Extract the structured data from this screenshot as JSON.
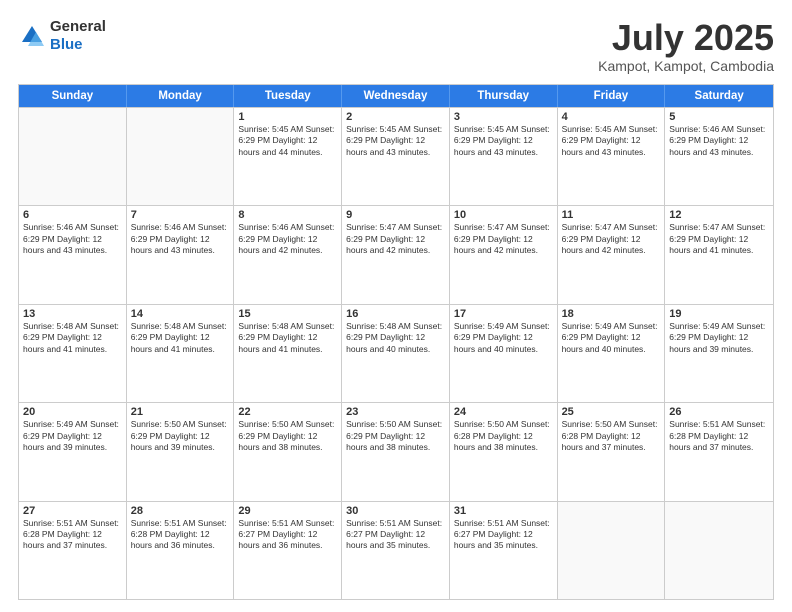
{
  "logo": {
    "general": "General",
    "blue": "Blue"
  },
  "title": "July 2025",
  "location": "Kampot, Kampot, Cambodia",
  "days_of_week": [
    "Sunday",
    "Monday",
    "Tuesday",
    "Wednesday",
    "Thursday",
    "Friday",
    "Saturday"
  ],
  "weeks": [
    [
      {
        "day": "",
        "info": "",
        "empty": true
      },
      {
        "day": "",
        "info": "",
        "empty": true
      },
      {
        "day": "1",
        "info": "Sunrise: 5:45 AM\nSunset: 6:29 PM\nDaylight: 12 hours and 44 minutes."
      },
      {
        "day": "2",
        "info": "Sunrise: 5:45 AM\nSunset: 6:29 PM\nDaylight: 12 hours and 43 minutes."
      },
      {
        "day": "3",
        "info": "Sunrise: 5:45 AM\nSunset: 6:29 PM\nDaylight: 12 hours and 43 minutes."
      },
      {
        "day": "4",
        "info": "Sunrise: 5:45 AM\nSunset: 6:29 PM\nDaylight: 12 hours and 43 minutes."
      },
      {
        "day": "5",
        "info": "Sunrise: 5:46 AM\nSunset: 6:29 PM\nDaylight: 12 hours and 43 minutes."
      }
    ],
    [
      {
        "day": "6",
        "info": "Sunrise: 5:46 AM\nSunset: 6:29 PM\nDaylight: 12 hours and 43 minutes."
      },
      {
        "day": "7",
        "info": "Sunrise: 5:46 AM\nSunset: 6:29 PM\nDaylight: 12 hours and 43 minutes."
      },
      {
        "day": "8",
        "info": "Sunrise: 5:46 AM\nSunset: 6:29 PM\nDaylight: 12 hours and 42 minutes."
      },
      {
        "day": "9",
        "info": "Sunrise: 5:47 AM\nSunset: 6:29 PM\nDaylight: 12 hours and 42 minutes."
      },
      {
        "day": "10",
        "info": "Sunrise: 5:47 AM\nSunset: 6:29 PM\nDaylight: 12 hours and 42 minutes."
      },
      {
        "day": "11",
        "info": "Sunrise: 5:47 AM\nSunset: 6:29 PM\nDaylight: 12 hours and 42 minutes."
      },
      {
        "day": "12",
        "info": "Sunrise: 5:47 AM\nSunset: 6:29 PM\nDaylight: 12 hours and 41 minutes."
      }
    ],
    [
      {
        "day": "13",
        "info": "Sunrise: 5:48 AM\nSunset: 6:29 PM\nDaylight: 12 hours and 41 minutes."
      },
      {
        "day": "14",
        "info": "Sunrise: 5:48 AM\nSunset: 6:29 PM\nDaylight: 12 hours and 41 minutes."
      },
      {
        "day": "15",
        "info": "Sunrise: 5:48 AM\nSunset: 6:29 PM\nDaylight: 12 hours and 41 minutes."
      },
      {
        "day": "16",
        "info": "Sunrise: 5:48 AM\nSunset: 6:29 PM\nDaylight: 12 hours and 40 minutes."
      },
      {
        "day": "17",
        "info": "Sunrise: 5:49 AM\nSunset: 6:29 PM\nDaylight: 12 hours and 40 minutes."
      },
      {
        "day": "18",
        "info": "Sunrise: 5:49 AM\nSunset: 6:29 PM\nDaylight: 12 hours and 40 minutes."
      },
      {
        "day": "19",
        "info": "Sunrise: 5:49 AM\nSunset: 6:29 PM\nDaylight: 12 hours and 39 minutes."
      }
    ],
    [
      {
        "day": "20",
        "info": "Sunrise: 5:49 AM\nSunset: 6:29 PM\nDaylight: 12 hours and 39 minutes."
      },
      {
        "day": "21",
        "info": "Sunrise: 5:50 AM\nSunset: 6:29 PM\nDaylight: 12 hours and 39 minutes."
      },
      {
        "day": "22",
        "info": "Sunrise: 5:50 AM\nSunset: 6:29 PM\nDaylight: 12 hours and 38 minutes."
      },
      {
        "day": "23",
        "info": "Sunrise: 5:50 AM\nSunset: 6:29 PM\nDaylight: 12 hours and 38 minutes."
      },
      {
        "day": "24",
        "info": "Sunrise: 5:50 AM\nSunset: 6:28 PM\nDaylight: 12 hours and 38 minutes."
      },
      {
        "day": "25",
        "info": "Sunrise: 5:50 AM\nSunset: 6:28 PM\nDaylight: 12 hours and 37 minutes."
      },
      {
        "day": "26",
        "info": "Sunrise: 5:51 AM\nSunset: 6:28 PM\nDaylight: 12 hours and 37 minutes."
      }
    ],
    [
      {
        "day": "27",
        "info": "Sunrise: 5:51 AM\nSunset: 6:28 PM\nDaylight: 12 hours and 37 minutes."
      },
      {
        "day": "28",
        "info": "Sunrise: 5:51 AM\nSunset: 6:28 PM\nDaylight: 12 hours and 36 minutes."
      },
      {
        "day": "29",
        "info": "Sunrise: 5:51 AM\nSunset: 6:27 PM\nDaylight: 12 hours and 36 minutes."
      },
      {
        "day": "30",
        "info": "Sunrise: 5:51 AM\nSunset: 6:27 PM\nDaylight: 12 hours and 35 minutes."
      },
      {
        "day": "31",
        "info": "Sunrise: 5:51 AM\nSunset: 6:27 PM\nDaylight: 12 hours and 35 minutes."
      },
      {
        "day": "",
        "info": "",
        "empty": true
      },
      {
        "day": "",
        "info": "",
        "empty": true
      }
    ]
  ]
}
